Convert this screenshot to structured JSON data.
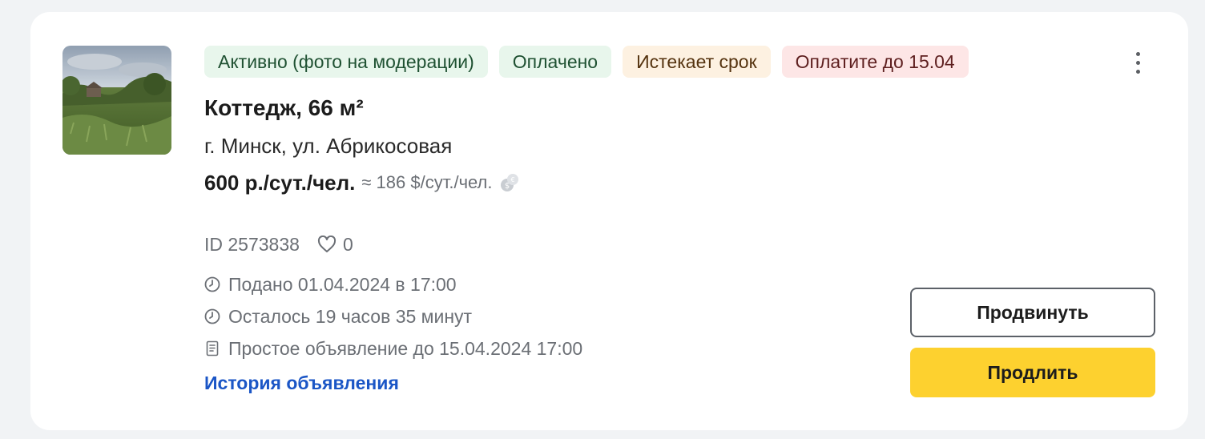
{
  "listing": {
    "badges": [
      {
        "label": "Активно (фото на модерации)",
        "variant": "green"
      },
      {
        "label": "Оплачено",
        "variant": "green"
      },
      {
        "label": "Истекает срок",
        "variant": "orange"
      },
      {
        "label": "Оплатите до 15.04",
        "variant": "red"
      }
    ],
    "title": "Коттедж, 66 м²",
    "address": "г. Минск, ул. Абрикосовая",
    "price": "600 р./сут./чел.",
    "price_approx": "≈ 186 $/сут./чел.",
    "id_label": "ID 2573838",
    "likes": "0",
    "submitted": "Подано 01.04.2024 в 17:00",
    "remaining": "Осталось 19 часов 35 минут",
    "plan": "Простое объявление до 15.04.2024 17:00",
    "history_link": "История объявления"
  },
  "actions": {
    "promote_label": "Продвинуть",
    "extend_label": "Продлить"
  },
  "icons": {
    "currency": "currency-exchange-icon",
    "heart": "heart-icon",
    "clock": "clock-icon",
    "document": "document-icon",
    "menu": "more-vertical-icon"
  },
  "colors": {
    "badge_green_bg": "#e8f6ec",
    "badge_orange_bg": "#fdf1e1",
    "badge_red_bg": "#fde6e6",
    "link": "#1b56c6",
    "extend_button": "#fdd12f"
  }
}
